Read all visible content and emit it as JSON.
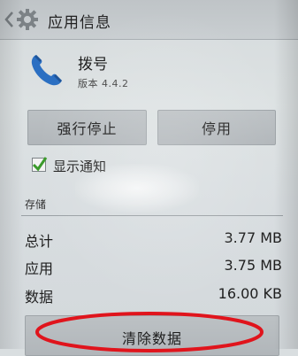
{
  "actionbar": {
    "title": "应用信息",
    "back_icon": "back-arrow-icon",
    "settings_icon": "gear-icon"
  },
  "app": {
    "name": "拨号",
    "version": "版本 4.4.2",
    "icon": "phone-icon",
    "icon_color": "#2b6fc2"
  },
  "buttons": {
    "force_stop": "强行停止",
    "disable": "停用",
    "clear_data": "清除数据"
  },
  "notifications": {
    "label": "显示通知",
    "checked": true,
    "check_color": "#3a9a2a"
  },
  "storage": {
    "header": "存储",
    "rows": [
      {
        "label": "总计",
        "value": "3.77 MB"
      },
      {
        "label": "应用",
        "value": "3.75 MB"
      },
      {
        "label": "数据",
        "value": "16.00 KB"
      }
    ]
  },
  "annotation": {
    "color": "#e0141c"
  }
}
